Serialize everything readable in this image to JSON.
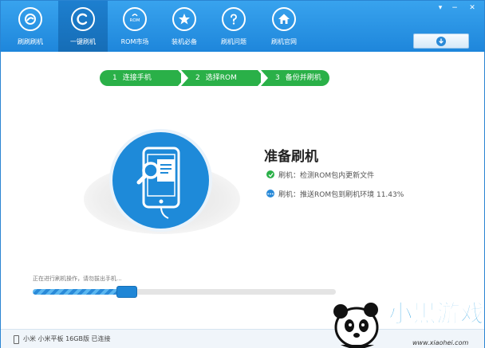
{
  "window": {
    "minimize_glyph": "−",
    "close_glyph": "✕",
    "menu_glyph": "▾"
  },
  "nav": [
    {
      "label": "刷刷刷机",
      "icon": "app-logo-icon"
    },
    {
      "label": "一键刷机",
      "icon": "refresh-c-icon"
    },
    {
      "label": "ROM市场",
      "icon": "rom-bag-icon"
    },
    {
      "label": "装机必备",
      "icon": "star-icon"
    },
    {
      "label": "刷机问题",
      "icon": "question-icon"
    },
    {
      "label": "刷机官网",
      "icon": "home-icon"
    }
  ],
  "rom_badge": "ROM",
  "steps": [
    {
      "num": "1",
      "label": "连接手机"
    },
    {
      "num": "2",
      "label": "选择ROM"
    },
    {
      "num": "3",
      "label": "备份并刷机"
    }
  ],
  "main": {
    "title": "准备刷机",
    "status": [
      {
        "text": "刷机：检测ROM包内更新文件",
        "state": "done",
        "icon": "check-icon"
      },
      {
        "text": "刷机：推送ROM包到刷机环境 11.43%",
        "state": "in-progress",
        "icon": "dots-icon"
      }
    ]
  },
  "progress": {
    "message": "正在进行刷机操作，请勿拔出手机...",
    "percent": 11.43
  },
  "footer": {
    "device": "小米 小米平板 16GB版 已连接"
  },
  "watermark": {
    "text": "小黑游戏",
    "url": "www.xiaohei.com"
  },
  "colors": {
    "primary": "#1e8ad9",
    "step_green": "#2ab048"
  }
}
